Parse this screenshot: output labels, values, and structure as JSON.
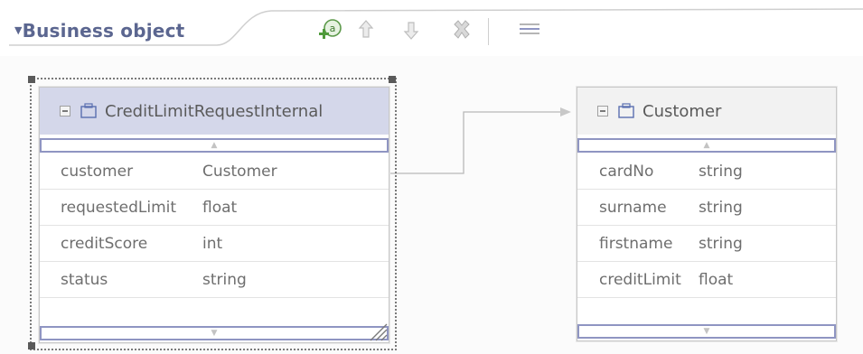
{
  "header": {
    "section_title": "Business object",
    "toolbar": [
      {
        "name": "add-attribute-button",
        "icon": "add-attribute-icon"
      },
      {
        "name": "move-up-button",
        "icon": "arrow-up-icon"
      },
      {
        "name": "move-down-button",
        "icon": "arrow-down-icon"
      },
      {
        "name": "delete-button",
        "icon": "delete-x-icon"
      },
      {
        "name": "show-properties-button",
        "icon": "list-lines-icon"
      }
    ]
  },
  "colors": {
    "title": "#5b6690",
    "header_bg_selected": "#d4d7ea",
    "header_bg": "#f0f0f0",
    "scroll_border": "#8f95c2",
    "connector": "#b8b8b8"
  },
  "objects": {
    "left": {
      "title": "CreditLimitRequestInternal",
      "selected": true,
      "attributes": [
        {
          "name": "customer",
          "type": "Customer"
        },
        {
          "name": "requestedLimit",
          "type": "float"
        },
        {
          "name": "creditScore",
          "type": "int"
        },
        {
          "name": "status",
          "type": "string"
        }
      ]
    },
    "right": {
      "title": "Customer",
      "selected": false,
      "attributes": [
        {
          "name": "cardNo",
          "type": "string"
        },
        {
          "name": "surname",
          "type": "string"
        },
        {
          "name": "firstname",
          "type": "string"
        },
        {
          "name": "creditLimit",
          "type": "float"
        }
      ]
    }
  }
}
